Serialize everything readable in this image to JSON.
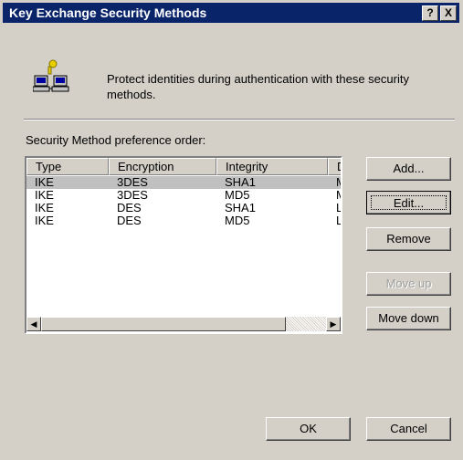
{
  "window": {
    "title": "Key Exchange Security Methods",
    "help_glyph": "?",
    "close_glyph": "X"
  },
  "header": {
    "icon": "network-computers-key-icon",
    "description": "Protect identities during authentication with these security methods."
  },
  "list": {
    "label": "Security Method preference order:",
    "columns": [
      "Type",
      "Encryption",
      "Integrity",
      "D"
    ],
    "rows": [
      {
        "type": "IKE",
        "encryption": "3DES",
        "integrity": "SHA1",
        "d": "M",
        "selected": true
      },
      {
        "type": "IKE",
        "encryption": "3DES",
        "integrity": "MD5",
        "d": "M",
        "selected": false
      },
      {
        "type": "IKE",
        "encryption": "DES",
        "integrity": "SHA1",
        "d": "L",
        "selected": false
      },
      {
        "type": "IKE",
        "encryption": "DES",
        "integrity": "MD5",
        "d": "L",
        "selected": false
      }
    ]
  },
  "buttons": {
    "add": "Add...",
    "edit": "Edit...",
    "remove": "Remove",
    "move_up": "Move up",
    "move_down": "Move down",
    "ok": "OK",
    "cancel": "Cancel"
  },
  "colors": {
    "titlebar": "#0a246a",
    "face": "#d4d0c8",
    "selection": "#c0c0c0"
  }
}
